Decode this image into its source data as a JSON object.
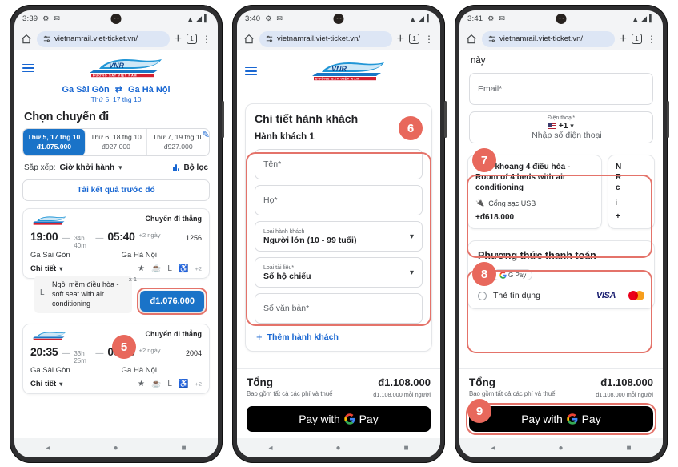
{
  "phones": [
    {
      "status": {
        "time": "3:39",
        "icons": [
          "gear-icon",
          "message-icon"
        ],
        "right": [
          "wifi",
          "signal",
          "battery"
        ]
      },
      "browser": {
        "url": "vietnamrail.viet-ticket.vn/",
        "tab_count": "1"
      },
      "brand": {
        "name": "VNR",
        "sub": "ĐƯỜNG SẮT VIỆT NAM"
      },
      "route": {
        "from": "Ga Sài Gòn",
        "to": "Ga Hà Nội",
        "date": "Thứ 5, 17 thg 10"
      },
      "title": "Chọn chuyến đi",
      "date_tabs": [
        {
          "day": "Thứ 5, 17 thg 10",
          "price": "đ1.075.000",
          "selected": true
        },
        {
          "day": "Thứ 6, 18 thg 10",
          "price": "đ927.000",
          "selected": false
        },
        {
          "day": "Thứ 7, 19 thg 10",
          "price": "đ927.000",
          "selected": false
        }
      ],
      "sort": {
        "label": "Sắp xếp:",
        "value": "Giờ khởi hành",
        "filter_label": "Bộ lọc"
      },
      "load_more": "Tải kết quả trước đó",
      "trips": [
        {
          "direct": "Chuyến đi thẳng",
          "depart_time": "19:00",
          "duration": "34h 40m",
          "arrive_time": "05:40",
          "plus_day": "+2 ngày",
          "train_no": "1256",
          "from": "Ga Sài Gòn",
          "to": "Ga Hà Nội",
          "detail": "Chi tiết",
          "amenities_more": "+2"
        },
        {
          "direct": "Chuyến đi thẳng",
          "depart_time": "20:35",
          "duration": "33h 25m",
          "arrive_time": "06:00",
          "plus_day": "+2 ngày",
          "train_no": "2004",
          "from": "Ga Sài Gòn",
          "to": "Ga Hà Nội",
          "detail": "Chi tiết",
          "amenities_more": "+2"
        }
      ],
      "seat_tooltip": {
        "text": "Ngồi mềm điều hòa - soft seat with air conditioning",
        "qty": "x 1"
      },
      "price_button": "đ1.076.000"
    },
    {
      "status": {
        "time": "3:40"
      },
      "browser": {
        "url": "vietnamrail.viet-ticket.vn/",
        "tab_count": "1"
      },
      "pax_title": "Chi tiết hành khách",
      "pax_subtitle": "Hành khách 1",
      "fields": [
        {
          "kind": "placeholder",
          "placeholder": "Tên*"
        },
        {
          "kind": "placeholder",
          "placeholder": "Họ*"
        },
        {
          "kind": "select",
          "label": "Loại hành khách",
          "value": "Người lớn (10 - 99 tuổi)"
        },
        {
          "kind": "select",
          "label": "Loại tài liệu*",
          "value": "Số hộ chiếu"
        },
        {
          "kind": "placeholder",
          "placeholder": "Số văn bản*"
        }
      ],
      "add_passenger": "Thêm hành khách",
      "total": {
        "label": "Tổng",
        "sub": "Bao gồm tất cả các phí và thuế",
        "amount": "đ1.108.000",
        "per_person": "đ1.108.000 mỗi người"
      },
      "pay_button": {
        "prefix": "Pay with",
        "suffix": "Pay"
      }
    },
    {
      "status": {
        "time": "3:41"
      },
      "browser": {
        "url": "vietnamrail.viet-ticket.vn/",
        "tab_count": "1"
      },
      "fragment_text": "này",
      "email_placeholder": "Email*",
      "phone_field": {
        "label": "Điện thoại*",
        "code": "+1",
        "placeholder": "Nhập số điện thoại"
      },
      "berths": [
        {
          "title": "Nằm khoang 4 điều hòa - Room of 4 beds with air conditioning",
          "amenity": "Cổng sạc USB",
          "price": "+đ618.000"
        },
        {
          "title": "N R c",
          "amenity": "i",
          "price": "+"
        }
      ],
      "payment": {
        "title": "Phương thức thanh toán",
        "option_gpay": "G Pay",
        "option_card": "Thẻ tín dụng",
        "card_brands": [
          "VISA",
          "mastercard"
        ]
      },
      "total": {
        "label": "Tổng",
        "sub": "Bao gồm tất cả các phí và thuế",
        "amount": "đ1.108.000",
        "per_person": "đ1.108.000 mỗi người"
      },
      "pay_button": {
        "prefix": "Pay with",
        "suffix": "Pay"
      }
    }
  ],
  "badges": [
    {
      "n": "5"
    },
    {
      "n": "6"
    },
    {
      "n": "7"
    },
    {
      "n": "8"
    },
    {
      "n": "9"
    }
  ],
  "colors": {
    "accent_blue": "#1a73c8",
    "badge_red": "#e8685c",
    "highlight_red": "#e4736a",
    "brand_red": "#d32030"
  }
}
